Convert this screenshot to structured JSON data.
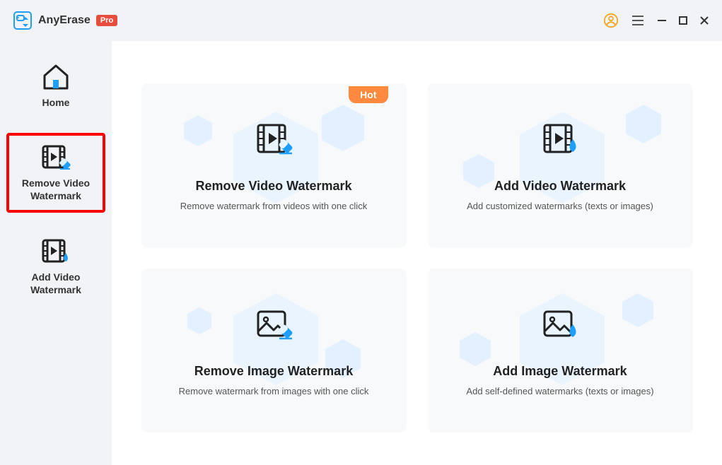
{
  "header": {
    "app_name": "AnyErase",
    "pro": "Pro"
  },
  "sidebar": {
    "items": [
      {
        "label": "Home"
      },
      {
        "label": "Remove Video Watermark"
      },
      {
        "label": "Add Video Watermark"
      }
    ]
  },
  "cards": [
    {
      "title": "Remove Video Watermark",
      "desc": "Remove watermark from videos with one click",
      "badge": "Hot"
    },
    {
      "title": "Add Video Watermark",
      "desc": "Add customized watermarks (texts or images)"
    },
    {
      "title": "Remove Image Watermark",
      "desc": "Remove watermark from images with one click"
    },
    {
      "title": "Add Image Watermark",
      "desc": "Add self-defined watermarks  (texts or images)"
    }
  ]
}
